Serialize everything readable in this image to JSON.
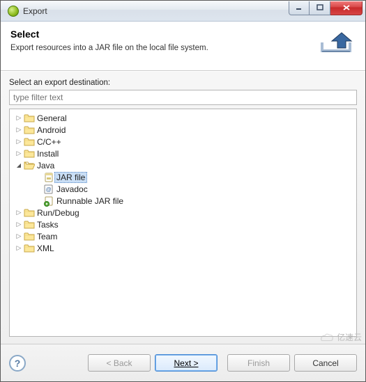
{
  "window": {
    "title": "Export"
  },
  "header": {
    "title": "Select",
    "subtitle": "Export resources into a JAR file on the local file system."
  },
  "body": {
    "instruction": "Select an export destination:",
    "filter_placeholder": "type filter text"
  },
  "tree": [
    {
      "label": "General",
      "type": "folder",
      "expanded": false,
      "depth": 0
    },
    {
      "label": "Android",
      "type": "folder",
      "expanded": false,
      "depth": 0
    },
    {
      "label": "C/C++",
      "type": "folder",
      "expanded": false,
      "depth": 0
    },
    {
      "label": "Install",
      "type": "folder",
      "expanded": false,
      "depth": 0
    },
    {
      "label": "Java",
      "type": "folder",
      "expanded": true,
      "depth": 0
    },
    {
      "label": "JAR file",
      "type": "leaf",
      "icon": "jar",
      "depth": 1,
      "selected": true
    },
    {
      "label": "Javadoc",
      "type": "leaf",
      "icon": "javadoc",
      "depth": 1
    },
    {
      "label": "Runnable JAR file",
      "type": "leaf",
      "icon": "run-jar",
      "depth": 1
    },
    {
      "label": "Run/Debug",
      "type": "folder",
      "expanded": false,
      "depth": 0
    },
    {
      "label": "Tasks",
      "type": "folder",
      "expanded": false,
      "depth": 0
    },
    {
      "label": "Team",
      "type": "folder",
      "expanded": false,
      "depth": 0
    },
    {
      "label": "XML",
      "type": "folder",
      "expanded": false,
      "depth": 0
    }
  ],
  "buttons": {
    "back": "< Back",
    "next": "Next >",
    "finish": "Finish",
    "cancel": "Cancel"
  },
  "watermark": "亿速云"
}
